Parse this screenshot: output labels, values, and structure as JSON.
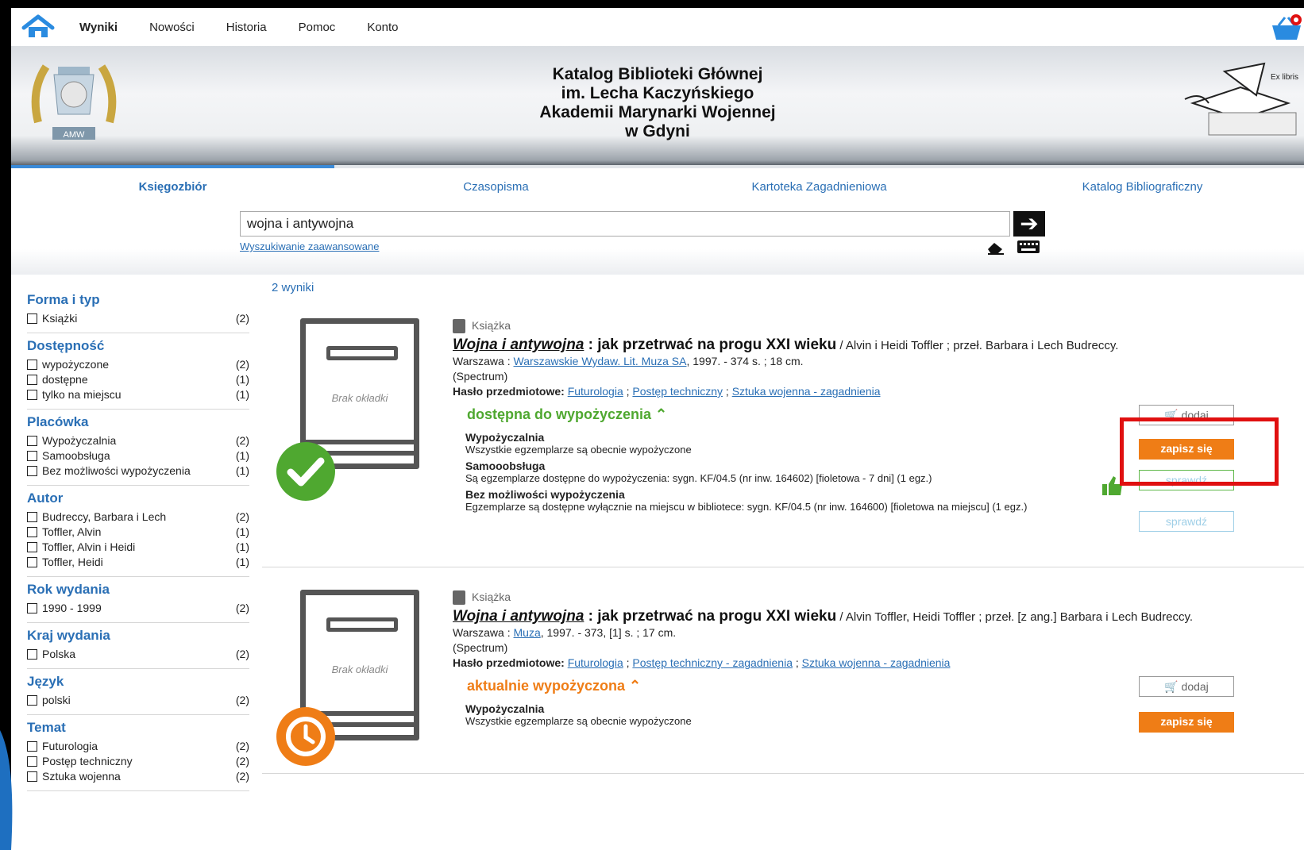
{
  "nav": {
    "items": [
      {
        "label": "Wyniki",
        "active": true
      },
      {
        "label": "Nowości",
        "active": false
      },
      {
        "label": "Historia",
        "active": false
      },
      {
        "label": "Pomoc",
        "active": false
      },
      {
        "label": "Konto",
        "active": false
      }
    ],
    "home_icon": "home-icon",
    "basket_icon": "basket-icon"
  },
  "header": {
    "title_lines": [
      "Katalog Biblioteki Głównej",
      "im. Lecha Kaczyńskiego",
      "Akademii Marynarki Wojennej",
      "w Gdyni"
    ],
    "logo_left_text": "AMW",
    "logo_right_text": "Ex libris"
  },
  "tabs": [
    {
      "label": "Księgozbiór",
      "active": true
    },
    {
      "label": "Czasopisma",
      "active": false
    },
    {
      "label": "Kartoteka Zagadnieniowa",
      "active": false
    },
    {
      "label": "Katalog Bibliograficzny",
      "active": false
    }
  ],
  "search": {
    "value": "wojna i antywojna",
    "advanced_link": "Wyszukiwanie zaawansowane",
    "go_symbol": "➔"
  },
  "facets": [
    {
      "title": "Forma i typ",
      "items": [
        {
          "label": "Książki",
          "count": "(2)"
        }
      ]
    },
    {
      "title": "Dostępność",
      "items": [
        {
          "label": "wypożyczone",
          "count": "(2)"
        },
        {
          "label": "dostępne",
          "count": "(1)"
        },
        {
          "label": "tylko na miejscu",
          "count": "(1)"
        }
      ]
    },
    {
      "title": "Placówka",
      "items": [
        {
          "label": "Wypożyczalnia",
          "count": "(2)"
        },
        {
          "label": "Samoobsługa",
          "count": "(1)"
        },
        {
          "label": "Bez możliwości wypożyczenia",
          "count": "(1)"
        }
      ]
    },
    {
      "title": "Autor",
      "items": [
        {
          "label": "Budrecсy, Barbara i Lech",
          "count": "(2)"
        },
        {
          "label": "Toffler, Alvin",
          "count": "(1)"
        },
        {
          "label": "Toffler, Alvin i Heidi",
          "count": "(1)"
        },
        {
          "label": "Toffler, Heidi",
          "count": "(1)"
        }
      ]
    },
    {
      "title": "Rok wydania",
      "items": [
        {
          "label": "1990 - 1999",
          "count": "(2)"
        }
      ]
    },
    {
      "title": "Kraj wydania",
      "items": [
        {
          "label": "Polska",
          "count": "(2)"
        }
      ]
    },
    {
      "title": "Język",
      "items": [
        {
          "label": "polski",
          "count": "(2)"
        }
      ]
    },
    {
      "title": "Temat",
      "items": [
        {
          "label": "Futurologia",
          "count": "(2)"
        },
        {
          "label": "Postęp techniczny",
          "count": "(2)"
        },
        {
          "label": "Sztuka wojenna",
          "count": "(2)"
        }
      ]
    }
  ],
  "results": {
    "count_label": "2 wyniki",
    "no_cover": "Brak okładki",
    "records": [
      {
        "type": "Książka",
        "title_main": "Wojna i antywojna",
        "title_rest": " : jak przetrwać na progu XXI wieku",
        "authors": " / Alvin i Heidi Toffler ; przeł. Barbara i Lech Budreccy.",
        "pub_prefix": "Warszawa : ",
        "publisher": "Warszawskie Wydaw. Lit. Muza SA",
        "pub_suffix": ", 1997. - 374 s. ; 18 cm.",
        "series": "(Spectrum)",
        "subjects_label": "Hasło przedmiotowe: ",
        "subjects": [
          "Futurologia",
          "Postęp techniczny",
          "Sztuka wojenna - zagadnienia"
        ],
        "availability": "dostępna do wypożyczenia ⌃",
        "availability_color": "#4fa830",
        "locations": [
          {
            "name": "Wypożyczalnia",
            "detail": "Wszystkie egzemplarze są obecnie wypożyczone"
          },
          {
            "name": "Samooobsługa",
            "detail": "Są egzemplarze dostępne do wypożyczenia: sygn. KF/04.5 (nr inw. 164602) [fioletowa - 7 dni] (1 egz.)"
          },
          {
            "name": "Bez możliwości wypożyczenia",
            "detail": "Egzemplarze są dostępne wyłącznie na miejscu w bibliotece: sygn. KF/04.5 (nr inw. 164600) [fioletowa na miejscu] (1 egz.)"
          }
        ],
        "buttons": {
          "add": "dodaj",
          "reserve": "zapisz się",
          "check1": "sprawdź",
          "check2": "sprawdź"
        },
        "status_icon": "check-icon"
      },
      {
        "type": "Książka",
        "title_main": "Wojna i antywojna",
        "title_rest": " : jak przetrwać na progu XXI wieku",
        "authors": " / Alvin Toffler, Heidi Toffler ; przeł. [z ang.] Barbara i Lech Budreccy.",
        "pub_prefix": "Warszawa : ",
        "publisher": "Muza",
        "pub_suffix": ", 1997. - 373, [1] s. ; 17 cm.",
        "series": "(Spectrum)",
        "subjects_label": "Hasło przedmiotowe: ",
        "subjects": [
          "Futurologia",
          "Postęp techniczny - zagadnienia",
          "Sztuka wojenna - zagadnienia"
        ],
        "availability": "aktualnie wypożyczona ⌃",
        "availability_color": "#ef7d16",
        "locations": [
          {
            "name": "Wypożyczalnia",
            "detail": "Wszystkie egzemplarze są obecnie wypożyczone"
          }
        ],
        "buttons": {
          "add": "dodaj",
          "reserve": "zapisz się"
        },
        "status_icon": "clock-icon"
      }
    ]
  },
  "colors": {
    "accent": "#2a6fb5",
    "green": "#4fa830",
    "orange": "#ef7d16",
    "highlight": "#e01010"
  }
}
